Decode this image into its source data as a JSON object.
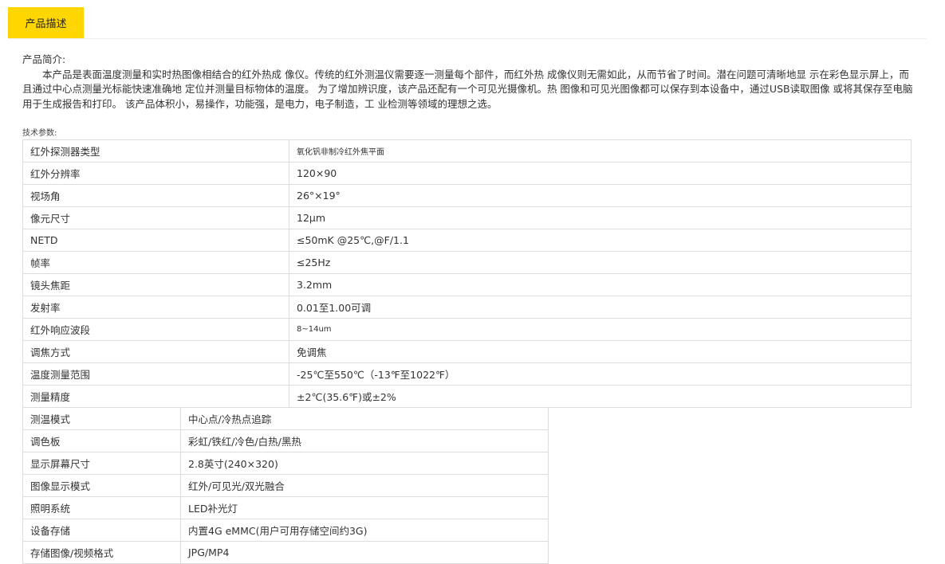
{
  "tabs": {
    "active_label": "产品描述"
  },
  "intro": {
    "title": "产品简介:",
    "body": "本产品是表面温度测量和实时热图像相结合的红外热成 像仪。传统的红外测温仪需要逐一测量每个部件，而红外热 成像仪则无需如此，从而节省了时间。潜在问题可清晰地显 示在彩色显示屏上，而且通过中心点测量光标能快速准确地 定位并测量目标物体的温度。 为了增加辨识度，该产品还配有一个可见光摄像机。热 图像和可见光图像都可以保存到本设备中，通过USB读取图像 或将其保存至电脑用于生成报告和打印。 该产品体积小，易操作，功能强，是电力，电子制造，工 业检测等领域的理想之选。"
  },
  "specs_label": "技术参数:",
  "table1": [
    {
      "key": "红外探测器类型",
      "value": "氧化钒非制冷红外焦平面"
    },
    {
      "key": "红外分辨率",
      "value": "120×90"
    },
    {
      "key": "视场角",
      "value": "26°×19°"
    },
    {
      "key": "像元尺寸",
      "value": "12μm"
    },
    {
      "key": "NETD",
      "value": "≤50mK @25℃,@F/1.1"
    },
    {
      "key": "帧率",
      "value": "≤25Hz"
    },
    {
      "key": "镜头焦距",
      "value": "3.2mm"
    },
    {
      "key": "发射率",
      "value": "0.01至1.00可调"
    },
    {
      "key": "红外响应波段",
      "value": "8~14um"
    },
    {
      "key": "调焦方式",
      "value": "免调焦"
    },
    {
      "key": "温度测量范围",
      "value": "-25℃至550℃（-13℉至1022℉）"
    },
    {
      "key": "测量精度",
      "value": "±2℃(35.6℉)或±2%"
    }
  ],
  "table2": [
    {
      "key": "测温模式",
      "value": "中心点/冷热点追踪"
    },
    {
      "key": "调色板",
      "value": "彩虹/铁红/冷色/白热/黑热"
    },
    {
      "key": "显示屏幕尺寸",
      "value": "2.8英寸(240×320)"
    },
    {
      "key": "图像显示模式",
      "value": "红外/可见光/双光融合"
    },
    {
      "key": "照明系统",
      "value": "LED补光灯"
    },
    {
      "key": "设备存储",
      "value": "内置4G eMMC(用户可用存储空间约3G)"
    },
    {
      "key": "存储图像/视频格式",
      "value": "JPG/MP4"
    }
  ]
}
